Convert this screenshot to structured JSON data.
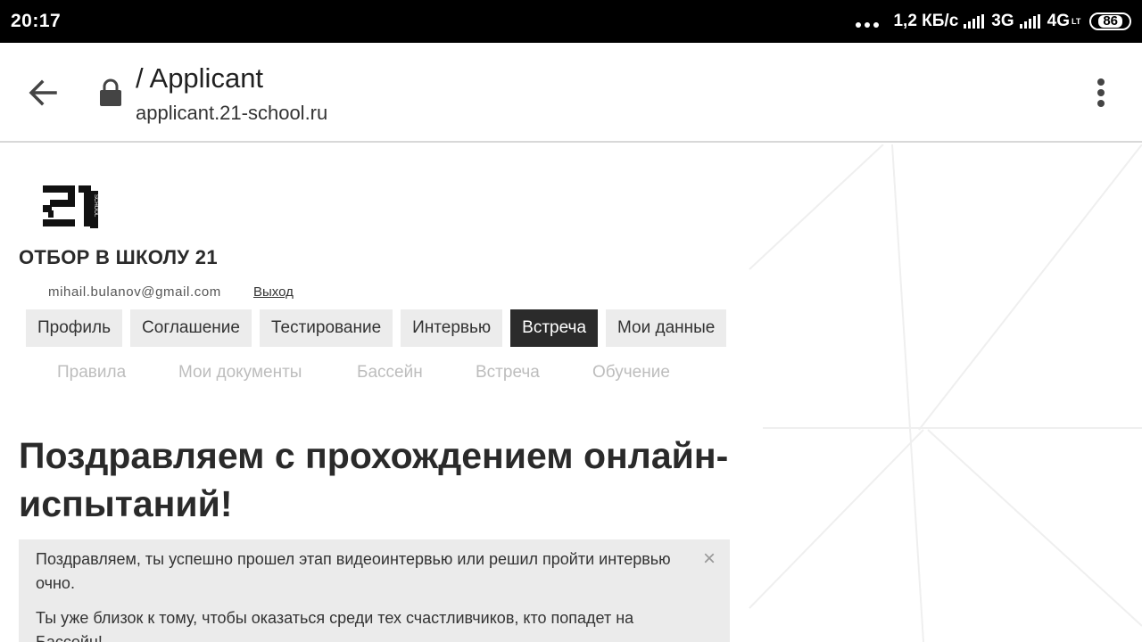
{
  "status_bar": {
    "time": "20:17",
    "network_speed": "1,2 КБ/с",
    "net1": "3G",
    "net2": "4G",
    "net2_sup": "LT",
    "battery": "86"
  },
  "browser": {
    "page_title": "/ Applicant",
    "host": "applicant.21-school.ru"
  },
  "site": {
    "title": "ОТБОР В ШКОЛУ 21",
    "logo_text": "SCHOOL",
    "user_email": "mihail.bulanov@gmail.com",
    "logout_label": "Выход"
  },
  "tabs": [
    {
      "label": "Профиль",
      "active": false
    },
    {
      "label": "Соглашение",
      "active": false
    },
    {
      "label": "Тестирование",
      "active": false
    },
    {
      "label": "Интервью",
      "active": false
    },
    {
      "label": "Встреча",
      "active": true
    },
    {
      "label": "Мои данные",
      "active": false
    }
  ],
  "subnav": [
    "Правила",
    "Мои документы",
    "Бассейн",
    "Встреча",
    "Обучение"
  ],
  "main": {
    "heading": "Поздравляем с прохождением онлайн-испытаний!",
    "alert_p1": "Поздравляем, ты успешно прошел этап видеоинтервью или решил пройти интервью очно.",
    "alert_p2": "Ты уже близок к тому, чтобы оказаться среди тех счастливчиков, кто попадет на Бассейн!",
    "alert_close": "×"
  }
}
